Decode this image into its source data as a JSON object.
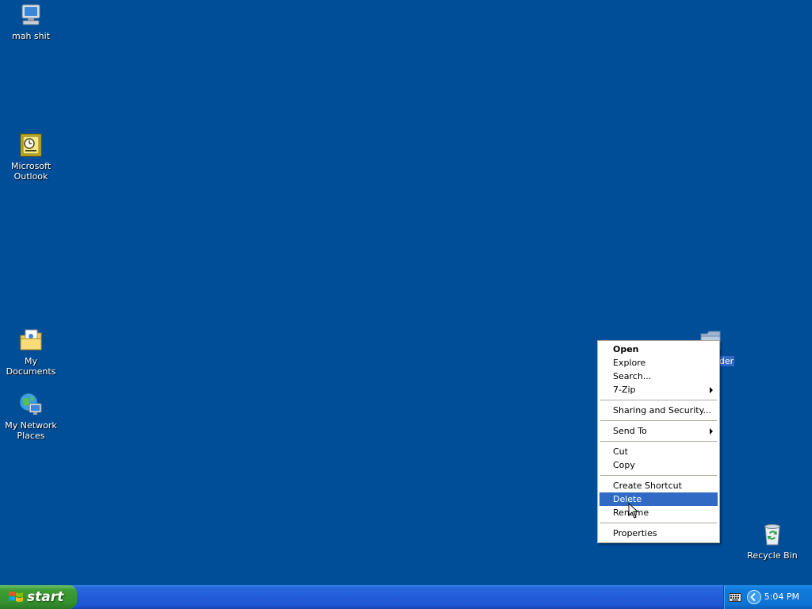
{
  "desktop": {
    "icons": [
      {
        "label": "mah shit",
        "icon": "my-computer-icon"
      },
      {
        "label": "Microsoft Outlook",
        "icon": "outlook-icon"
      },
      {
        "label": "My Documents",
        "icon": "my-documents-icon"
      },
      {
        "label": "My Network Places",
        "icon": "network-places-icon"
      },
      {
        "label": "Recycle Bin",
        "icon": "recycle-bin-icon"
      },
      {
        "label": "der",
        "icon": "folder-icon"
      }
    ]
  },
  "context_menu": {
    "items": {
      "open": "Open",
      "explore": "Explore",
      "search": "Search...",
      "seven_zip": "7-Zip",
      "sharing": "Sharing and Security...",
      "send_to": "Send To",
      "cut": "Cut",
      "copy": "Copy",
      "create_shortcut": "Create Shortcut",
      "delete": "Delete",
      "rename": "Rename",
      "properties": "Properties"
    },
    "highlighted": "Delete"
  },
  "taskbar": {
    "start_label": "start",
    "clock": "5:04 PM"
  },
  "colors": {
    "desktop_bg": "#004e98",
    "highlight": "#316ac5",
    "start_green": "#3c9e35",
    "taskbar_blue": "#245edb"
  }
}
